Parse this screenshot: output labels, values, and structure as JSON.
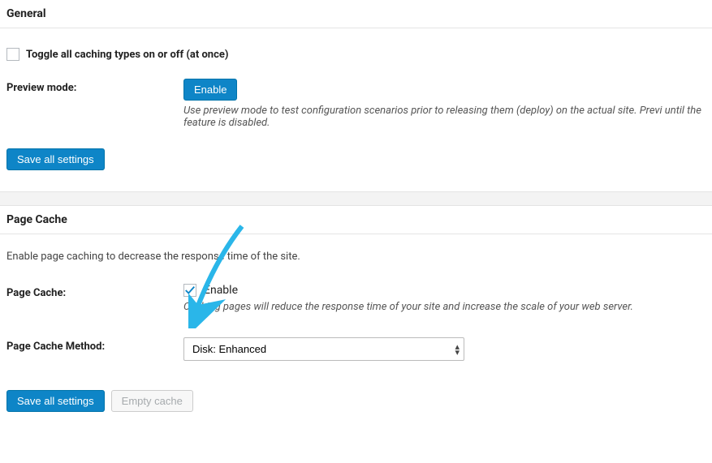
{
  "general": {
    "header": "General",
    "toggle_all_label": "Toggle all caching types on or off (at once)",
    "toggle_all_checked": false,
    "preview_mode_label": "Preview mode:",
    "preview_enable_button": "Enable",
    "preview_helper": "Use preview mode to test configuration scenarios prior to releasing them (deploy) on the actual site. Previ until the feature is disabled.",
    "save_button": "Save all settings"
  },
  "page_cache": {
    "header": "Page Cache",
    "description": "Enable page caching to decrease the response time of the site.",
    "page_cache_label": "Page Cache:",
    "enable_checked": true,
    "enable_label": "Enable",
    "enable_helper": "Caching pages will reduce the response time of your site and increase the scale of your web server.",
    "method_label": "Page Cache Method:",
    "method_value": "Disk: Enhanced",
    "save_button": "Save all settings",
    "empty_cache_button": "Empty cache"
  }
}
